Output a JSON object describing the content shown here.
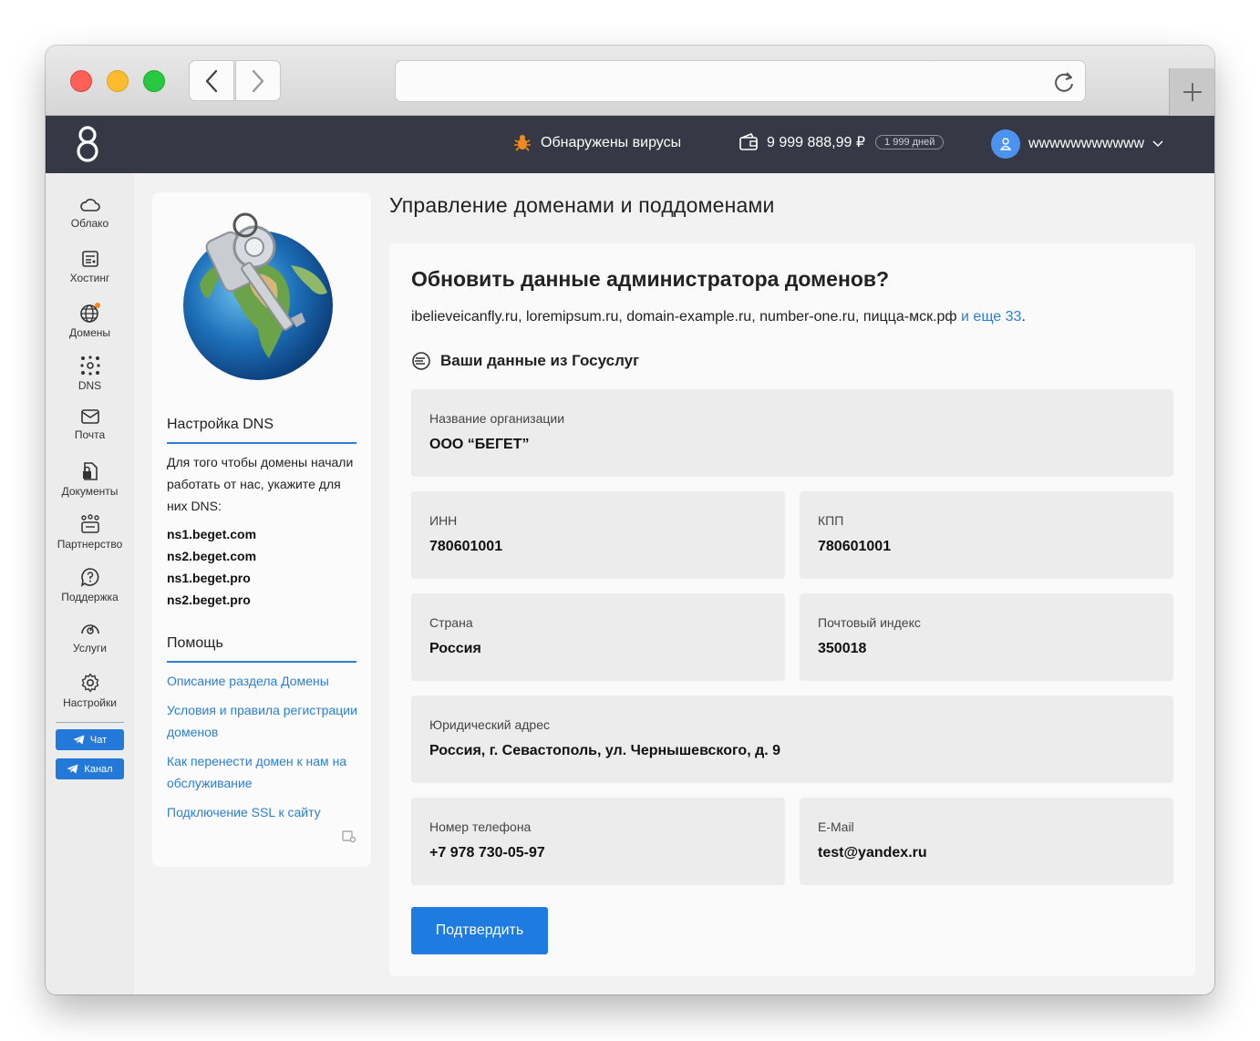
{
  "header": {
    "virus_text": "Обнаружены вирусы",
    "balance": "9 999 888,99 ₽",
    "days_left": "1 999 дней",
    "username": "wwwwwwwwwww"
  },
  "leftnav": {
    "items": [
      {
        "label": "Облако"
      },
      {
        "label": "Хостинг"
      },
      {
        "label": "Домены"
      },
      {
        "label": "DNS"
      },
      {
        "label": "Почта"
      },
      {
        "label": "Документы"
      },
      {
        "label": "Партнерство"
      },
      {
        "label": "Поддержка"
      },
      {
        "label": "Услуги"
      },
      {
        "label": "Настройки"
      }
    ],
    "chat_label": "Чат",
    "channel_label": "Канал"
  },
  "info_panel": {
    "dns_heading": "Настройка DNS",
    "dns_text": "Для того чтобы домены начали работать от нас, укажите для них DNS:",
    "ns": [
      "ns1.beget.com",
      "ns2.beget.com",
      "ns1.beget.pro",
      "ns2.beget.pro"
    ],
    "help_heading": "Помощь",
    "help_links": [
      "Описание раздела Домены",
      "Условия и правила регистрации доменов",
      "Как перенести домен к нам на обслуживание",
      "Подключение SSL к сайту"
    ]
  },
  "main": {
    "page_title": "Управление доменами и поддоменами",
    "card_title": "Обновить данные администратора доменов?",
    "domains_text": "ibelieveicanfly.ru, loremipsum.ru, domain-example.ru, number-one.ru, пицца-мск.рф",
    "domains_more": "и еще 33",
    "gosuslugi_heading": "Ваши данные из Госуслуг",
    "fields": {
      "org": {
        "label": "Название организации",
        "value": "ООО “БЕГЕТ”"
      },
      "inn": {
        "label": "ИНН",
        "value": "780601001"
      },
      "kpp": {
        "label": "КПП",
        "value": "780601001"
      },
      "country": {
        "label": "Страна",
        "value": "Россия"
      },
      "postal": {
        "label": "Почтовый индекс",
        "value": "350018"
      },
      "address": {
        "label": "Юридический адрес",
        "value": "Россия, г. Севастополь, ул. Чернышевского, д. 9"
      },
      "phone": {
        "label": "Номер телефона",
        "value": "+7 978 730-05-97"
      },
      "email": {
        "label": "E-Mail",
        "value": "test@yandex.ru"
      }
    },
    "confirm_label": "Подтвердить"
  },
  "colors": {
    "accent": "#1e7be0",
    "link": "#2a7fd4",
    "header_bg": "#363945",
    "field_bg": "#ececec"
  }
}
